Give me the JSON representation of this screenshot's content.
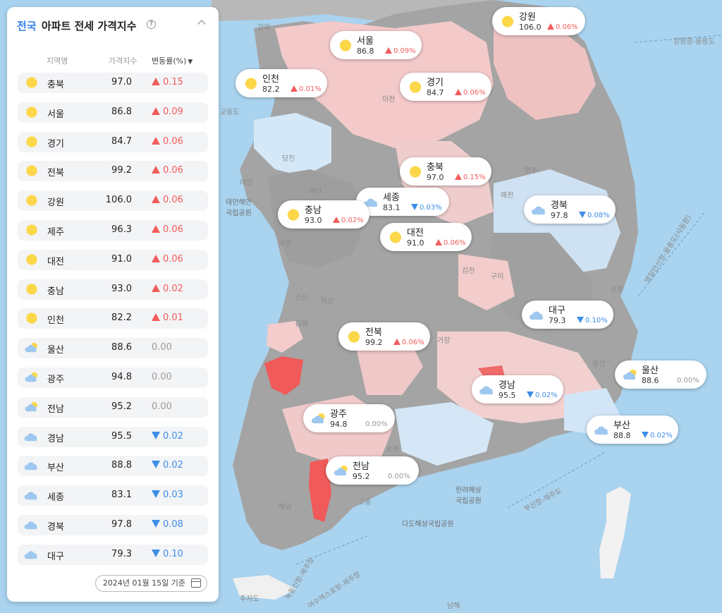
{
  "panel": {
    "title_accent": "전국",
    "title_rest": "아파트 전세 가격지수",
    "headers": {
      "region": "지역명",
      "index": "가격지수",
      "change": "변동률(%)"
    },
    "rows": [
      {
        "name": "충북",
        "value": "97.0",
        "change": "0.15",
        "dir": "up",
        "icon": "sun-icon"
      },
      {
        "name": "서울",
        "value": "86.8",
        "change": "0.09",
        "dir": "up",
        "icon": "sun-icon"
      },
      {
        "name": "경기",
        "value": "84.7",
        "change": "0.06",
        "dir": "up",
        "icon": "sun-icon"
      },
      {
        "name": "전북",
        "value": "99.2",
        "change": "0.06",
        "dir": "up",
        "icon": "sun-icon"
      },
      {
        "name": "강원",
        "value": "106.0",
        "change": "0.06",
        "dir": "up",
        "icon": "sun-icon"
      },
      {
        "name": "제주",
        "value": "96.3",
        "change": "0.06",
        "dir": "up",
        "icon": "sun-icon"
      },
      {
        "name": "대전",
        "value": "91.0",
        "change": "0.06",
        "dir": "up",
        "icon": "sun-icon"
      },
      {
        "name": "충남",
        "value": "93.0",
        "change": "0.02",
        "dir": "up",
        "icon": "sun-icon"
      },
      {
        "name": "인천",
        "value": "82.2",
        "change": "0.01",
        "dir": "up",
        "icon": "sun-icon"
      },
      {
        "name": "울산",
        "value": "88.6",
        "change": "0.00",
        "dir": "flat",
        "icon": "partly-cloudy-icon"
      },
      {
        "name": "광주",
        "value": "94.8",
        "change": "0.00",
        "dir": "flat",
        "icon": "partly-cloudy-icon"
      },
      {
        "name": "전남",
        "value": "95.2",
        "change": "0.00",
        "dir": "flat",
        "icon": "partly-cloudy-icon"
      },
      {
        "name": "경남",
        "value": "95.5",
        "change": "0.02",
        "dir": "down",
        "icon": "cloud-icon"
      },
      {
        "name": "부산",
        "value": "88.8",
        "change": "0.02",
        "dir": "down",
        "icon": "cloud-icon"
      },
      {
        "name": "세종",
        "value": "83.1",
        "change": "0.03",
        "dir": "down",
        "icon": "cloud-icon"
      },
      {
        "name": "경북",
        "value": "97.8",
        "change": "0.08",
        "dir": "down",
        "icon": "cloud-icon"
      },
      {
        "name": "대구",
        "value": "79.3",
        "change": "0.10",
        "dir": "down",
        "icon": "cloud-icon"
      }
    ],
    "date_label": "2024년 01월 15일 기준"
  },
  "map": {
    "cards": [
      {
        "name": "강원",
        "value": "106.0",
        "change": "0.06%",
        "dir": "up",
        "icon": "sun-icon"
      },
      {
        "name": "서울",
        "value": "86.8",
        "change": "0.09%",
        "dir": "up",
        "icon": "sun-icon"
      },
      {
        "name": "인천",
        "value": "82.2",
        "change": "0.01%",
        "dir": "up",
        "icon": "sun-icon"
      },
      {
        "name": "경기",
        "value": "84.7",
        "change": "0.06%",
        "dir": "up",
        "icon": "sun-icon"
      },
      {
        "name": "충북",
        "value": "97.0",
        "change": "0.15%",
        "dir": "up",
        "icon": "sun-icon"
      },
      {
        "name": "세종",
        "value": "83.1",
        "change": "0.03%",
        "dir": "down",
        "icon": "cloud-icon"
      },
      {
        "name": "충남",
        "value": "93.0",
        "change": "0.02%",
        "dir": "up",
        "icon": "sun-icon"
      },
      {
        "name": "경북",
        "value": "97.8",
        "change": "0.08%",
        "dir": "down",
        "icon": "cloud-icon"
      },
      {
        "name": "대전",
        "value": "91.0",
        "change": "0.06%",
        "dir": "up",
        "icon": "sun-icon"
      },
      {
        "name": "대구",
        "value": "79.3",
        "change": "0.10%",
        "dir": "down",
        "icon": "cloud-icon"
      },
      {
        "name": "전북",
        "value": "99.2",
        "change": "0.06%",
        "dir": "up",
        "icon": "sun-icon"
      },
      {
        "name": "울산",
        "value": "88.6",
        "change": "0.00%",
        "dir": "flat",
        "icon": "partly-cloudy-icon"
      },
      {
        "name": "경남",
        "value": "95.5",
        "change": "0.02%",
        "dir": "down",
        "icon": "cloud-icon"
      },
      {
        "name": "광주",
        "value": "94.8",
        "change": "0.00%",
        "dir": "flat",
        "icon": "partly-cloudy-icon"
      },
      {
        "name": "부산",
        "value": "88.8",
        "change": "0.02%",
        "dir": "down",
        "icon": "cloud-icon"
      },
      {
        "name": "전남",
        "value": "95.2",
        "change": "0.00%",
        "dir": "flat",
        "icon": "partly-cloudy-icon"
      }
    ],
    "labels": {
      "ganghwa": "강화",
      "gyodong": "교동도",
      "dangjin": "당진",
      "taean": "태안",
      "taean_park": "태안해안\n국립공원",
      "yesan": "예산",
      "boryeong": "보령",
      "gunsan": "군산",
      "iksan": "익산",
      "gimje": "김제",
      "yeongju": "영주",
      "yecheon": "예천",
      "gimcheon": "김천",
      "gumi": "구미",
      "pohang": "포항",
      "geochang": "거창",
      "suncheon": "순천",
      "goheung": "고흥",
      "haenam": "해남",
      "dadohae": "다도해상국립공원",
      "hallyeo": "한려해상\n국립공원",
      "chuja": "추자도",
      "busan_route": "부산항-제주도",
      "gangneung_route": "강릉항-울릉도",
      "yeongil_route": "영일만신항-울릉도(사동항)",
      "jeju_route": "녹동신항-제주항",
      "yeosu_route": "여수엑스포항-제주항",
      "namhae": "남해",
      "jeongok": "울산",
      "icheon": "이천"
    },
    "colors": {
      "sea": "#a9d3ef",
      "land_gray": "#a6a6a6",
      "land_pink": "#f3c9c9",
      "land_red": "#f05a5a",
      "land_blue": "#d4e8f8"
    }
  }
}
